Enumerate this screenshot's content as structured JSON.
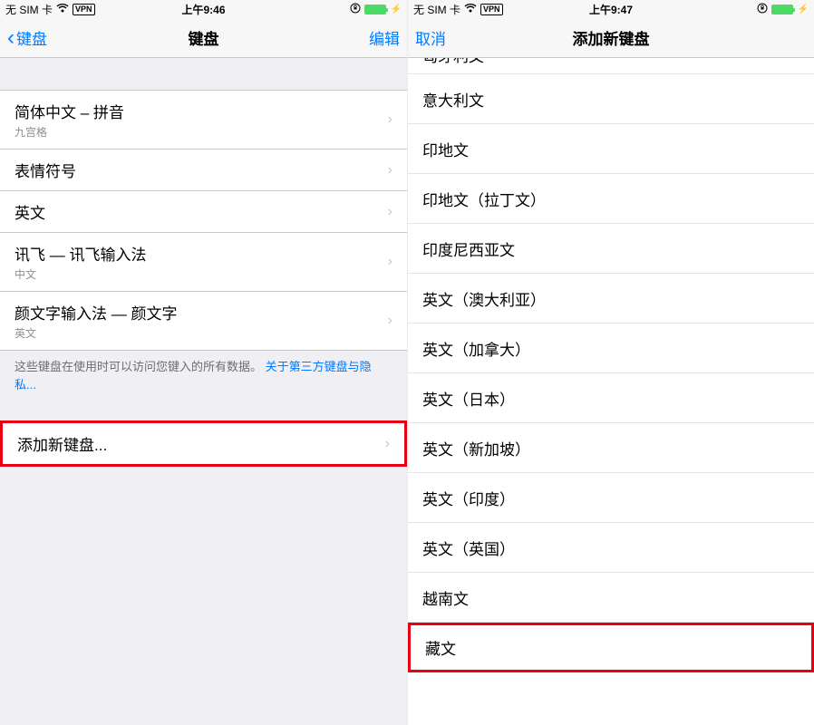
{
  "left": {
    "status": {
      "carrier": "无 SIM 卡",
      "vpn": "VPN",
      "time": "上午9:46"
    },
    "nav": {
      "back": "键盘",
      "title": "键盘",
      "edit": "编辑"
    },
    "keyboards": [
      {
        "title": "简体中文 – 拼音",
        "sub": "九宫格"
      },
      {
        "title": "表情符号",
        "sub": ""
      },
      {
        "title": "英文",
        "sub": ""
      },
      {
        "title": "讯飞 — 讯飞输入法",
        "sub": "中文"
      },
      {
        "title": "颜文字输入法 — 颜文字",
        "sub": "英文"
      }
    ],
    "footer_text": "这些键盘在使用时可以访问您键入的所有数据。",
    "footer_link": "关于第三方键盘与隐私...",
    "add_row": "添加新键盘..."
  },
  "right": {
    "status": {
      "carrier": "无 SIM 卡",
      "vpn": "VPN",
      "time": "上午9:47"
    },
    "nav": {
      "cancel": "取消",
      "title": "添加新键盘"
    },
    "partial_top": "匈牙利文",
    "languages": [
      "意大利文",
      "印地文",
      "印地文（拉丁文）",
      "印度尼西亚文",
      "英文（澳大利亚）",
      "英文（加拿大）",
      "英文（日本）",
      "英文（新加坡）",
      "英文（印度）",
      "英文（英国）",
      "越南文",
      "藏文"
    ],
    "highlight_index": 11
  }
}
